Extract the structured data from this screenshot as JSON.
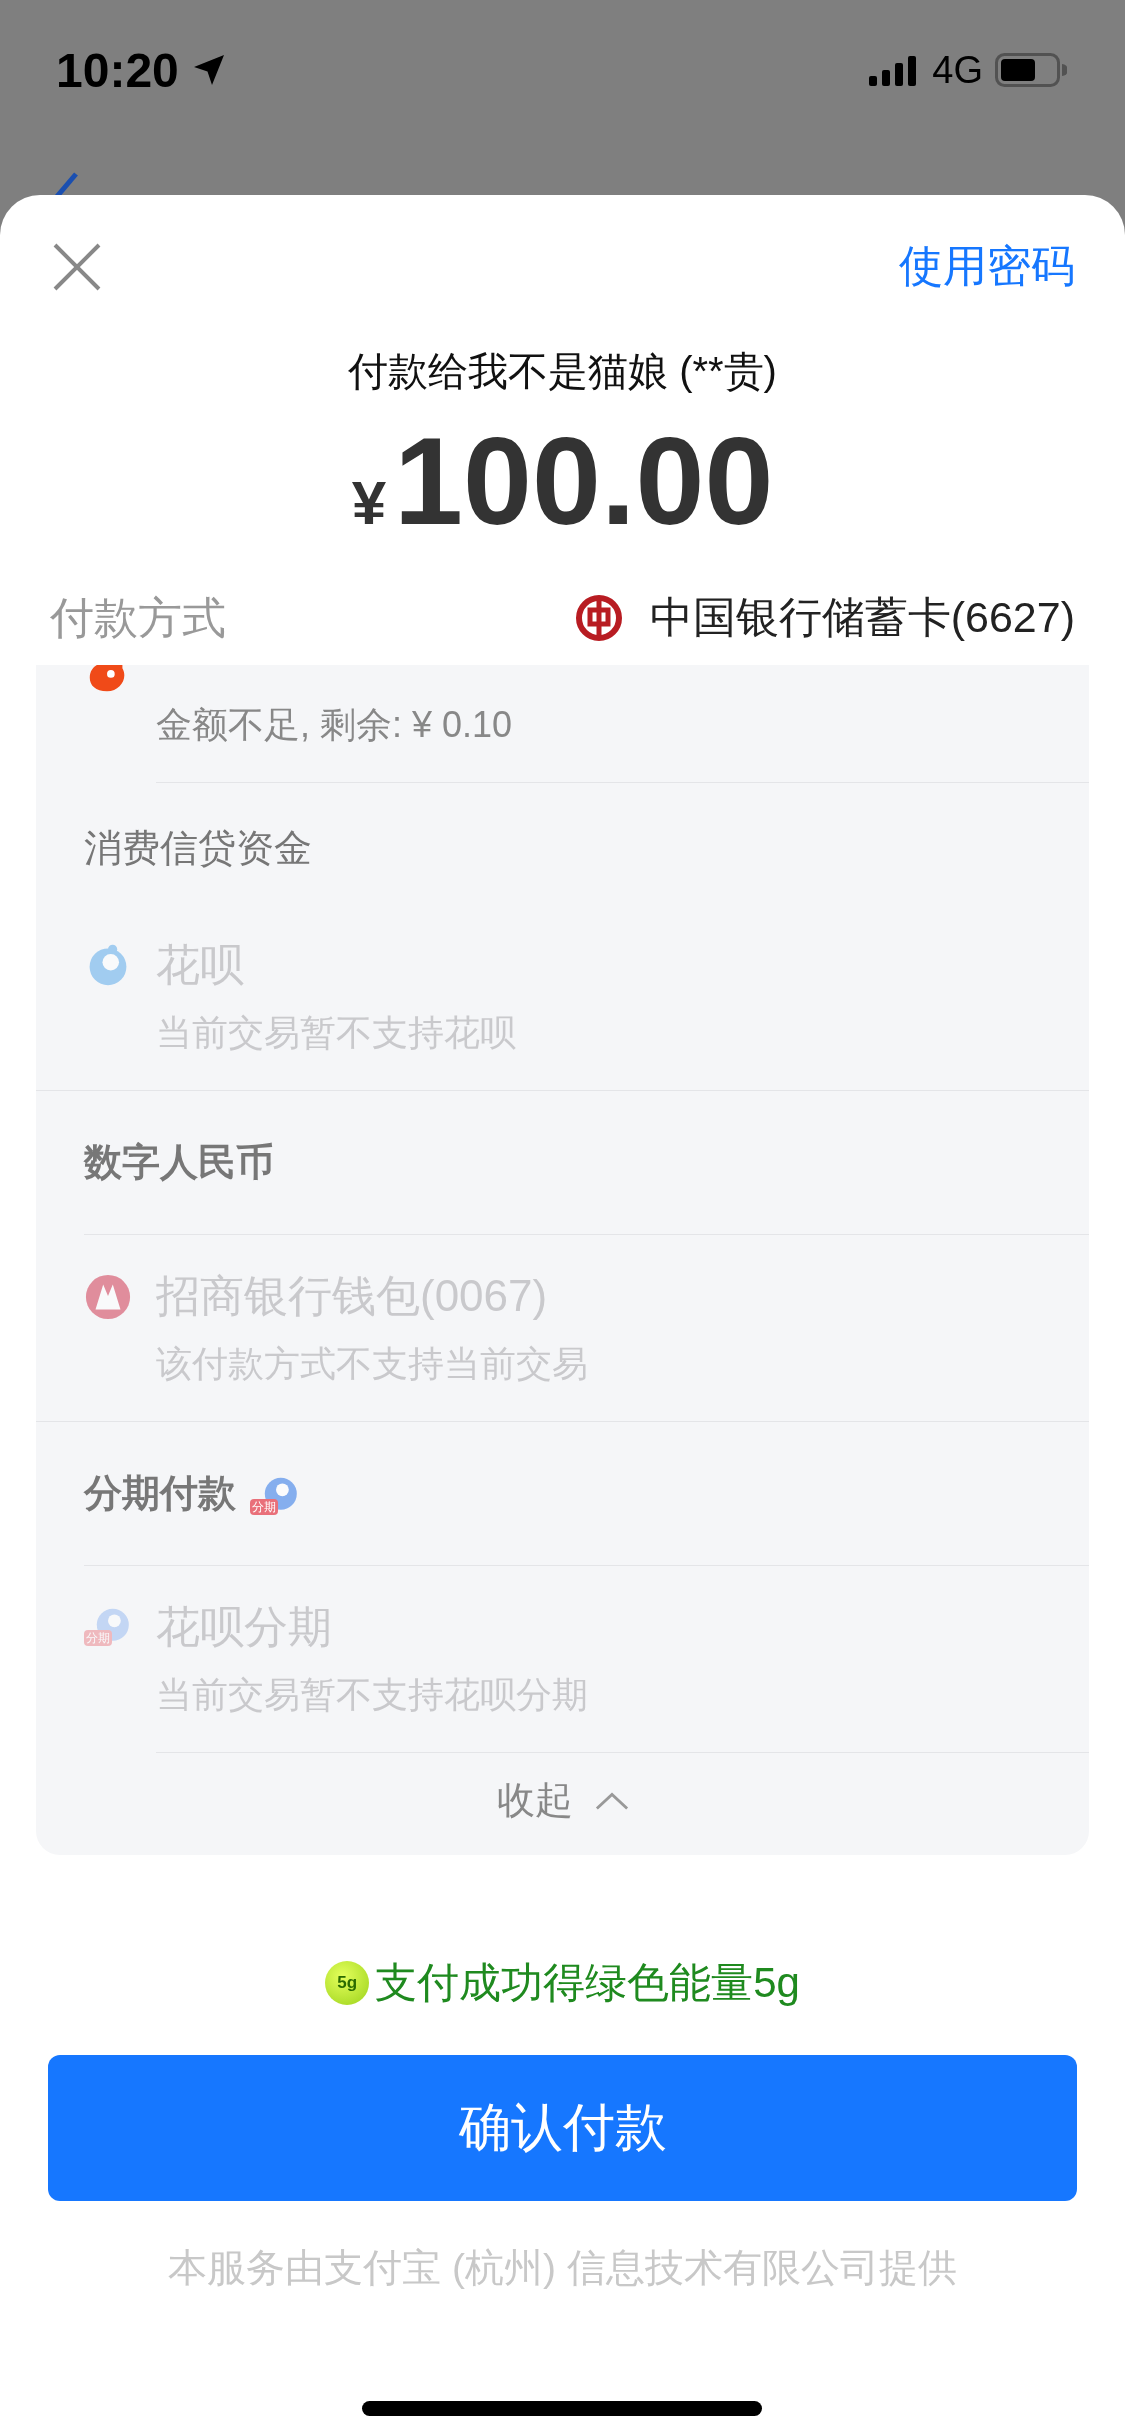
{
  "status_bar": {
    "time": "10:20",
    "network": "4G"
  },
  "sheet": {
    "password_link": "使用密码",
    "payee": "付款给我不是猫娘 (**贵)",
    "currency": "¥",
    "amount": "100.00",
    "method_label": "付款方式",
    "selected_method": "中国银行储蓄卡(6627)"
  },
  "methods": [
    {
      "kind": "option",
      "subtitle": "金额不足, 剩余: ¥ 0.10",
      "disabled": false
    },
    {
      "kind": "header",
      "title": "消费信贷资金",
      "bold": false
    },
    {
      "kind": "option",
      "title": "花呗",
      "subtitle": "当前交易暂不支持花呗",
      "disabled": true
    },
    {
      "kind": "header",
      "title": "数字人民币",
      "bold": true
    },
    {
      "kind": "option",
      "title": "招商银行钱包(0067)",
      "subtitle": "该付款方式不支持当前交易",
      "disabled": true
    },
    {
      "kind": "header",
      "title": "分期付款",
      "bold": true,
      "badge": "分期"
    },
    {
      "kind": "option",
      "title": "花呗分期",
      "subtitle": "当前交易暂不支持花呗分期",
      "disabled": true,
      "badge": "分期"
    }
  ],
  "collapse": "收起",
  "energy": {
    "badge": "5g",
    "text": "支付成功得绿色能量5g"
  },
  "confirm_button": "确认付款",
  "footer": "本服务由支付宝 (杭州) 信息技术有限公司提供"
}
